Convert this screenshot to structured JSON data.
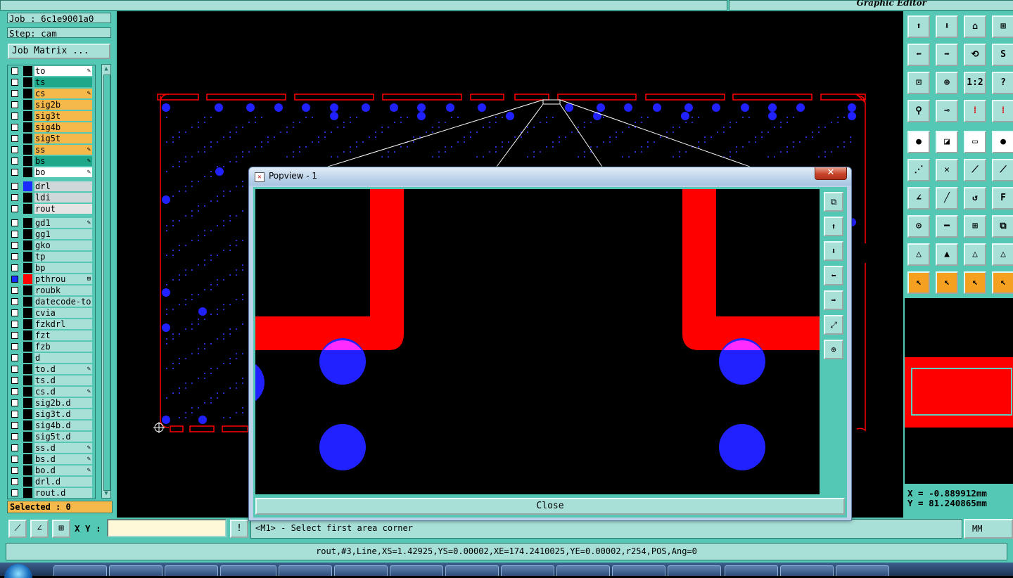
{
  "app": {
    "title": "Graphic Editor"
  },
  "job": {
    "job_label": "Job : 6c1e9001a0",
    "step_label": "Step: cam",
    "matrix_button": "Job Matrix ..."
  },
  "colors": {
    "teal": "#54c8b4",
    "pale": "#a8e0d8",
    "yellow": "#f5b84a",
    "green": "#1fa88a",
    "white": "#ffffff",
    "gray": "#cfd8d8",
    "blue_drl": "#1a2cff",
    "red": "#ff0000",
    "pad_blue": "#2121ff"
  },
  "layers": [
    {
      "name": "to",
      "bg": "#ffffff",
      "swatch": "#000000",
      "mark": "✎"
    },
    {
      "name": "ts",
      "bg": "#1fa88a",
      "swatch": "#000000",
      "mark": ""
    },
    {
      "name": "cs",
      "bg": "#f5b84a",
      "swatch": "#000000",
      "mark": "✎"
    },
    {
      "name": "sig2b",
      "bg": "#f5b84a",
      "swatch": "#000000",
      "mark": ""
    },
    {
      "name": "sig3t",
      "bg": "#f5b84a",
      "swatch": "#000000",
      "mark": ""
    },
    {
      "name": "sig4b",
      "bg": "#f5b84a",
      "swatch": "#000000",
      "mark": ""
    },
    {
      "name": "sig5t",
      "bg": "#f5b84a",
      "swatch": "#000000",
      "mark": ""
    },
    {
      "name": "ss",
      "bg": "#f5b84a",
      "swatch": "#000000",
      "mark": "✎"
    },
    {
      "name": "bs",
      "bg": "#1fa88a",
      "swatch": "#000000",
      "mark": "✎"
    },
    {
      "name": "bo",
      "bg": "#ffffff",
      "swatch": "#000000",
      "mark": "✎",
      "sep_after": true
    },
    {
      "name": "drl",
      "bg": "#cfd8d8",
      "swatch": "#1a2cff",
      "mark": ""
    },
    {
      "name": "ldi",
      "bg": "#cfd8d8",
      "swatch": "#000000",
      "mark": ""
    },
    {
      "name": "rout",
      "bg": "#e4e4e4",
      "swatch": "#000000",
      "mark": "",
      "sep_after": true
    },
    {
      "name": "gd1",
      "bg": "#a8e0d8",
      "swatch": "#000000",
      "mark": "✎"
    },
    {
      "name": "gg1",
      "bg": "#a8e0d8",
      "swatch": "#000000",
      "mark": ""
    },
    {
      "name": "gko",
      "bg": "#a8e0d8",
      "swatch": "#000000",
      "mark": ""
    },
    {
      "name": "tp",
      "bg": "#a8e0d8",
      "swatch": "#000000",
      "mark": ""
    },
    {
      "name": "bp",
      "bg": "#a8e0d8",
      "swatch": "#000000",
      "mark": ""
    },
    {
      "name": "pthrou",
      "bg": "#a8e0d8",
      "swatch": "#ff0000",
      "mark": "⊞",
      "check": "#1a2cff"
    },
    {
      "name": "roubk",
      "bg": "#a8e0d8",
      "swatch": "#000000",
      "mark": ""
    },
    {
      "name": "datecode-to",
      "bg": "#a8e0d8",
      "swatch": "#000000",
      "mark": ""
    },
    {
      "name": "cvia",
      "bg": "#a8e0d8",
      "swatch": "#000000",
      "mark": ""
    },
    {
      "name": "fzkdrl",
      "bg": "#a8e0d8",
      "swatch": "#000000",
      "mark": ""
    },
    {
      "name": "fzt",
      "bg": "#a8e0d8",
      "swatch": "#000000",
      "mark": ""
    },
    {
      "name": "fzb",
      "bg": "#a8e0d8",
      "swatch": "#000000",
      "mark": ""
    },
    {
      "name": "d",
      "bg": "#a8e0d8",
      "swatch": "#000000",
      "mark": ""
    },
    {
      "name": "to.d",
      "bg": "#a8e0d8",
      "swatch": "#000000",
      "mark": "✎"
    },
    {
      "name": "ts.d",
      "bg": "#a8e0d8",
      "swatch": "#000000",
      "mark": ""
    },
    {
      "name": "cs.d",
      "bg": "#a8e0d8",
      "swatch": "#000000",
      "mark": "✎"
    },
    {
      "name": "sig2b.d",
      "bg": "#a8e0d8",
      "swatch": "#000000",
      "mark": ""
    },
    {
      "name": "sig3t.d",
      "bg": "#a8e0d8",
      "swatch": "#000000",
      "mark": ""
    },
    {
      "name": "sig4b.d",
      "bg": "#a8e0d8",
      "swatch": "#000000",
      "mark": ""
    },
    {
      "name": "sig5t.d",
      "bg": "#a8e0d8",
      "swatch": "#000000",
      "mark": ""
    },
    {
      "name": "ss.d",
      "bg": "#a8e0d8",
      "swatch": "#000000",
      "mark": "✎"
    },
    {
      "name": "bs.d",
      "bg": "#a8e0d8",
      "swatch": "#000000",
      "mark": "✎"
    },
    {
      "name": "bo.d",
      "bg": "#a8e0d8",
      "swatch": "#000000",
      "mark": "✎"
    },
    {
      "name": "drl.d",
      "bg": "#a8e0d8",
      "swatch": "#000000",
      "mark": ""
    },
    {
      "name": "rout.d",
      "bg": "#a8e0d8",
      "swatch": "#000000",
      "mark": ""
    }
  ],
  "selection": {
    "label": "Selected : 0"
  },
  "popview": {
    "title": "Popview - 1",
    "close_x": "✕",
    "close_button": "Close",
    "icon": "popview-window-icon"
  },
  "popview_tools": [
    "zoom-extents-icon",
    "pan-up-icon",
    "pan-down-icon",
    "pan-left-icon",
    "pan-right-icon",
    "zoom-in-icon",
    "zoom-out-icon"
  ],
  "toolbar": [
    {
      "icon": "pan-up-icon",
      "glyph": "⬆",
      "style": ""
    },
    {
      "icon": "pan-down-icon",
      "glyph": "⬇",
      "style": ""
    },
    {
      "icon": "home-icon",
      "glyph": "⌂",
      "style": ""
    },
    {
      "icon": "view-split-icon",
      "glyph": "⊞",
      "style": ""
    },
    {
      "icon": "pan-left-icon",
      "glyph": "⬅",
      "style": ""
    },
    {
      "icon": "pan-right-icon",
      "glyph": "➡",
      "style": ""
    },
    {
      "icon": "redraw-icon",
      "glyph": "⟲",
      "style": ""
    },
    {
      "icon": "snap-s-icon",
      "glyph": "S",
      "style": ""
    },
    {
      "icon": "zoom-fit-icon",
      "glyph": "⊡",
      "style": ""
    },
    {
      "icon": "zoom-center-icon",
      "glyph": "⊕",
      "style": ""
    },
    {
      "icon": "zoom-one-to-two-icon",
      "glyph": "1:2",
      "style": ""
    },
    {
      "icon": "help-icon",
      "glyph": "?",
      "style": ""
    },
    {
      "icon": "measure-tool-icon",
      "glyph": "⚲",
      "style": ""
    },
    {
      "icon": "key-icon",
      "glyph": "⊸",
      "style": ""
    },
    {
      "icon": "net-highlight-icon",
      "glyph": "⁞",
      "style": ""
    },
    {
      "icon": "net-highlight-alt-icon",
      "glyph": "⁞",
      "style": ""
    },
    {
      "icon": "add-pad-icon",
      "glyph": "●",
      "style": "white"
    },
    {
      "icon": "add-surface-icon",
      "glyph": "◪",
      "style": "white"
    },
    {
      "icon": "ruler-icon",
      "glyph": "▭",
      "style": "white"
    },
    {
      "icon": "pad-dot-icon",
      "glyph": "●",
      "style": "white"
    },
    {
      "icon": "connect-icon",
      "glyph": "⋰",
      "style": ""
    },
    {
      "icon": "cross-icon",
      "glyph": "✕",
      "style": ""
    },
    {
      "icon": "line-node-icon",
      "glyph": "⟋",
      "style": ""
    },
    {
      "icon": "line-end-icon",
      "glyph": "⟋",
      "style": ""
    },
    {
      "icon": "angle-icon",
      "glyph": "∠",
      "style": ""
    },
    {
      "icon": "diagonal-line-icon",
      "glyph": "╱",
      "style": ""
    },
    {
      "icon": "arc-icon",
      "glyph": "↺",
      "style": ""
    },
    {
      "icon": "text-font-icon",
      "glyph": "F",
      "style": ""
    },
    {
      "icon": "pad-move-icon",
      "glyph": "⊙",
      "style": ""
    },
    {
      "icon": "horizontal-line-icon",
      "glyph": "━",
      "style": ""
    },
    {
      "icon": "cross-pad-icon",
      "glyph": "⊞",
      "style": ""
    },
    {
      "icon": "group-icon",
      "glyph": "⧉",
      "style": ""
    },
    {
      "icon": "triangle-icon",
      "glyph": "△",
      "style": ""
    },
    {
      "icon": "triangle-up-icon",
      "glyph": "▲",
      "style": ""
    },
    {
      "icon": "triangle-outline-icon",
      "glyph": "△",
      "style": ""
    },
    {
      "icon": "triangle-alt-icon",
      "glyph": "△",
      "style": ""
    },
    {
      "icon": "select-pointer-icon",
      "glyph": "↖",
      "style": "orange"
    },
    {
      "icon": "select-box-icon",
      "glyph": "↖",
      "style": "orange"
    },
    {
      "icon": "select-area-icon",
      "glyph": "↖",
      "style": "orange"
    },
    {
      "icon": "select-net-icon",
      "glyph": "↖",
      "style": "orange"
    }
  ],
  "coords": {
    "x_label": "X = -0.889912mm",
    "y_label": "Y = 81.240865mm"
  },
  "command": {
    "xy_label": "X Y :",
    "xy_value": "",
    "prompt": "<M1> - Select first area corner",
    "units": "MM"
  },
  "command_tools": [
    "snap-grid-icon",
    "snap-angle-icon",
    "snap-center-icon",
    "alert-icon"
  ],
  "status": {
    "text": "rout,#3,Line,XS=1.42925,YS=0.00002,XE=174.2410025,YE=0.00002,r254,POS,Ang=0"
  }
}
